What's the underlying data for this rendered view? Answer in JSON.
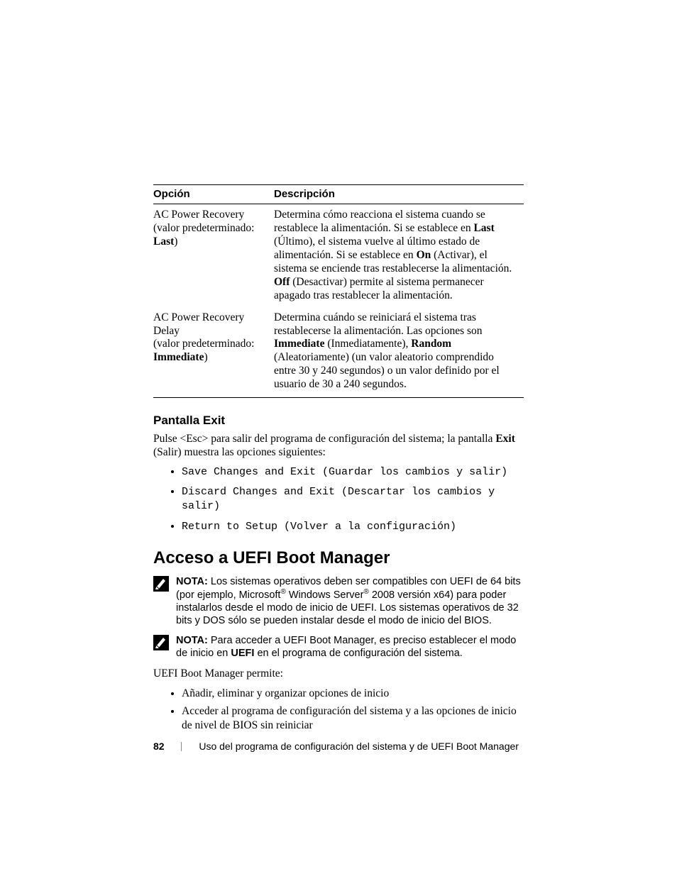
{
  "table": {
    "headers": {
      "option": "Opción",
      "description": "Descripción"
    },
    "rows": [
      {
        "option_html": "AC Power Recovery<br>(valor predeterminado:<br><b>Last</b>)",
        "desc_html": "Determina cómo reacciona el sistema cuando se restablece la alimentación. Si se establece en <b>Last</b> (Último), el sistema vuelve al último estado de alimentación. Si se establece en <b>On</b> (Activar), el sistema se enciende tras restablecerse la alimentación. <b>Off</b> (Desactivar) permite al sistema permanecer apagado tras restablecer la alimentación."
      },
      {
        "option_html": "AC Power Recovery Delay<br>(valor predeterminado:<br><b>Immediate</b>)",
        "desc_html": "Determina cuándo se reiniciará el sistema tras restablecerse la alimentación. Las opciones son <b>Immediate</b> (Inmediatamente), <b>Random</b> (Aleatoriamente) (un valor aleatorio comprendido entre 30 y 240 segundos) o un valor definido por el usuario de 30 a 240 segundos."
      }
    ]
  },
  "exit": {
    "heading": "Pantalla Exit",
    "para_html": "Pulse &lt;Esc&gt; para salir del programa de configuración del sistema; la pantalla <b>Exit</b> (Salir) muestra las opciones siguientes:",
    "items": [
      "Save Changes and Exit (Guardar los cambios y salir)",
      "Discard Changes and Exit (Descartar los cambios y salir)",
      "Return to Setup (Volver a la configuración)"
    ]
  },
  "uefi": {
    "title": "Acceso a UEFI Boot Manager",
    "nota_label": "NOTA:",
    "nota1_html": "Los sistemas operativos deben ser compatibles con UEFI de 64 bits (por ejemplo, Microsoft<sup>®</sup> Windows Server<sup>®</sup> 2008 versión x64) para poder instalarlos desde el modo de inicio de UEFI. Los sistemas operativos de 32 bits y DOS sólo se pueden instalar desde el modo de inicio del BIOS.",
    "nota2_html": "Para acceder a UEFI Boot Manager, es preciso establecer el modo de inicio en <b>UEFI</b> en el programa de configuración del sistema.",
    "intro": "UEFI Boot Manager permite:",
    "bullets": [
      "Añadir, eliminar y organizar opciones de inicio",
      "Acceder al programa de configuración del sistema y a las opciones de inicio de nivel de BIOS sin reiniciar"
    ]
  },
  "footer": {
    "page": "82",
    "text": "Uso del programa de configuración del sistema y de UEFI Boot Manager"
  }
}
